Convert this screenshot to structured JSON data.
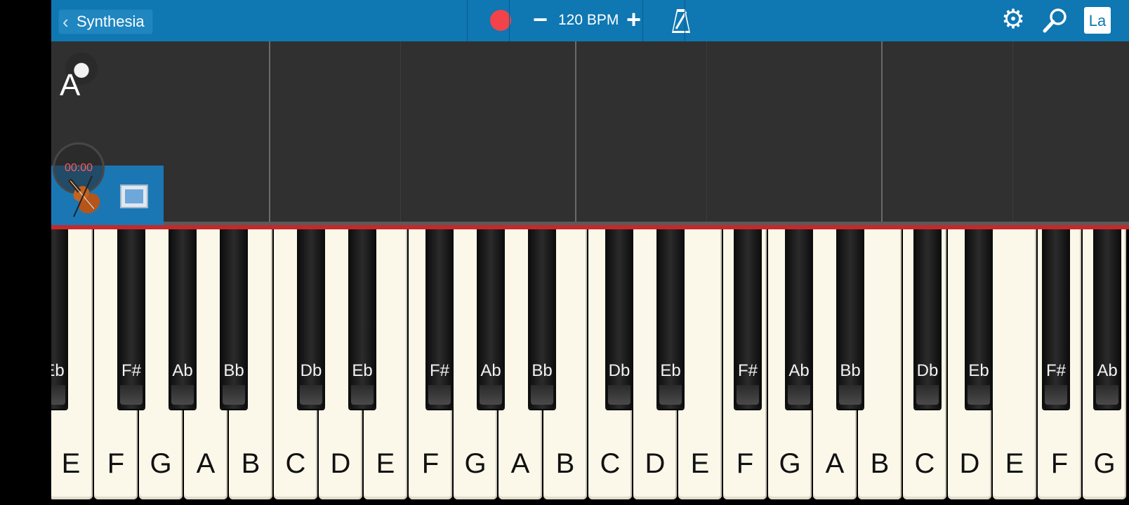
{
  "toolbar": {
    "back_label": "Synthesia",
    "bpm_label": "120 BPM",
    "bpm_minus": "−",
    "bpm_plus": "+",
    "lang_label": "La"
  },
  "roll": {
    "hand_label": "A",
    "timer": "00:00"
  },
  "keyboard": {
    "white_keys": [
      "E",
      "F",
      "G",
      "A",
      "B",
      "C",
      "D",
      "E",
      "F",
      "G",
      "A",
      "B",
      "C",
      "D",
      "E",
      "F",
      "G",
      "A",
      "B",
      "C",
      "D",
      "E",
      "F",
      "G"
    ],
    "black_keys": [
      "Eb",
      "F#",
      "Ab",
      "Bb",
      "Db",
      "Eb",
      "F#",
      "Ab",
      "Bb",
      "Db",
      "Eb",
      "F#",
      "Ab",
      "Bb",
      "Db",
      "Eb",
      "F#",
      "Ab"
    ]
  },
  "colors": {
    "toolbar_bg": "#0f77b2",
    "record": "#f2434a",
    "roll_bg": "#303030",
    "keyboard_edge": "#c6282b"
  },
  "icons": [
    "back-chevron-icon",
    "record-icon",
    "metronome-icon",
    "gear-icon",
    "search-icon",
    "violin-icon",
    "screen-icon"
  ]
}
